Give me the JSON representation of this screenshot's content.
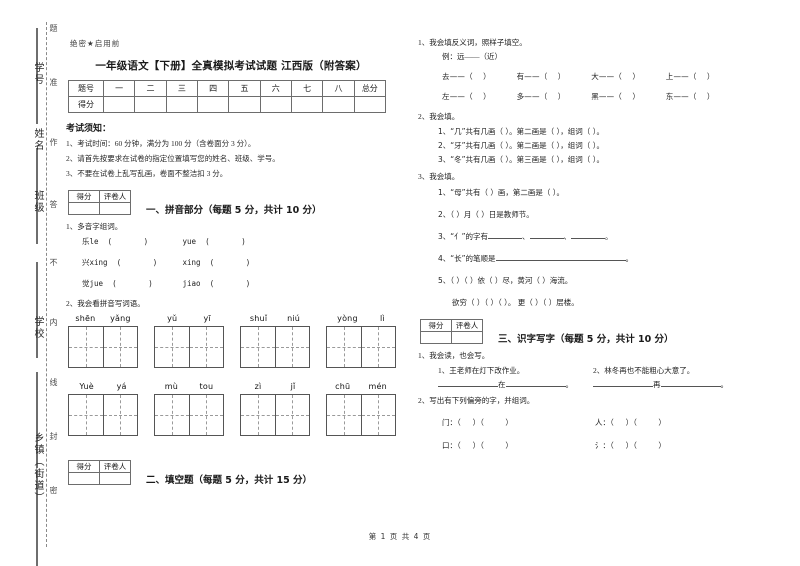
{
  "document": {
    "secret_notice": "绝密★启用前",
    "title": "一年级语文【下册】全真模拟考试试题  江西版（附答案）",
    "footer": "第 1 页 共 4 页"
  },
  "seal_strip": {
    "labels": [
      "学号",
      "姓名",
      "班级",
      "学校",
      "乡镇（街道）"
    ],
    "side_chars": [
      "题",
      "准",
      "作",
      "答",
      "不",
      "内",
      "线",
      "封",
      "密"
    ]
  },
  "score_table": {
    "row_labels": [
      "题号",
      "得分"
    ],
    "columns": [
      "一",
      "二",
      "三",
      "四",
      "五",
      "六",
      "七",
      "八"
    ],
    "total_label": "总分"
  },
  "notice": {
    "heading": "考试须知：",
    "items": [
      "1、考试时间：60 分钟，满分为 100 分（含卷面分 3 分）。",
      "2、请首先按要求在试卷的指定位置填写您的姓名、班级、学号。",
      "3、不要在试卷上乱写乱画，卷面不整洁扣 3 分。"
    ]
  },
  "grader_box": {
    "score_label": "得分",
    "marker_label": "评卷人"
  },
  "sections": [
    {
      "id": "section-one",
      "title": "一、拼音部分（每题 5 分，共计 10 分）",
      "q1_title": "1、多音字组词。",
      "duoyinzi": [
        {
          "han": "乐",
          "pinyin_a": "le",
          "pinyin_b": "yue"
        },
        {
          "han": "兴",
          "pinyin_a": "xing",
          "pinyin_b": "xing"
        },
        {
          "han": "觉",
          "pinyin_a": "jue",
          "pinyin_b": "jiao"
        }
      ],
      "q2_title": "2、我会看拼音写词语。",
      "pinyin_grid": [
        [
          [
            "shēn",
            "yǎng"
          ],
          [
            "yǔ",
            "yī"
          ],
          [
            "shuǐ",
            "niú"
          ],
          [
            "yòng",
            "lì"
          ]
        ],
        [
          [
            "Yuè",
            "yá"
          ],
          [
            "mù",
            "tou"
          ],
          [
            "zì",
            "jǐ"
          ],
          [
            "chū",
            "mén"
          ]
        ]
      ]
    },
    {
      "id": "section-two",
      "title": "二、填空题（每题 5 分，共计 15 分）"
    },
    {
      "id": "section-three",
      "title": "三、识字写字（每题 5 分，共计 10 分）",
      "q1_title": "1、我会读，也会写。",
      "read_write": [
        {
          "text": "1、王老师在灯下改作业。",
          "blank_word": "在"
        },
        {
          "text": "2、林冬再也不能粗心大意了。",
          "blank_word": "再"
        }
      ],
      "q2_title": "2、写出有下列偏旁的字，并组词。",
      "radicals": [
        "门",
        "人",
        "口",
        "氵"
      ]
    }
  ],
  "right_column": {
    "q1": {
      "title": "1、我会填反义词，照样子填空。",
      "example": "例：远——（近）",
      "row1": [
        "去",
        "有",
        "大",
        "上"
      ],
      "row2": [
        "左",
        "多",
        "黑",
        "东"
      ]
    },
    "q2": {
      "title": "2、我会填。",
      "items": [
        "1、“几”共有几画（    ）。第二画是（    ），组词（      ）。",
        "2、“牙”共有几画（    ）。第二画是（    ），组词（      ）。",
        "3、“冬”共有几画（    ）。第三画是（    ），组词（      ）。"
      ]
    },
    "q3": {
      "title": "3、我会填。",
      "items": [
        "1、“母”共有（   ）画，第二画是（   ）。",
        "2、（   ）月（   ）日是教师节。",
        "3、“亻”的字有",
        "4、“长”的笔顺是",
        "5、（   ）（   ）依（   ）尽，黄河（    ）海流。",
        "欲穷（   ）（   ）（   ）。  更（   ）（   ）层楼。"
      ]
    }
  }
}
